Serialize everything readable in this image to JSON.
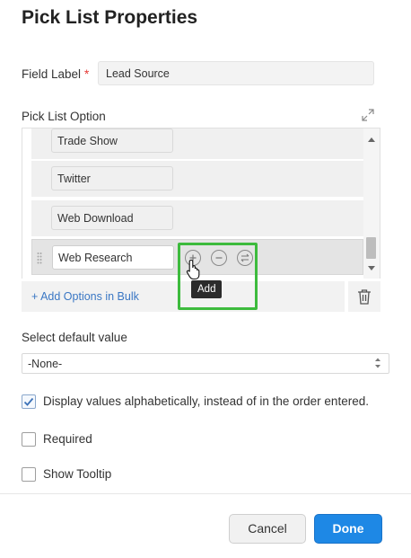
{
  "header": {
    "title": "Pick List Properties"
  },
  "field_label": {
    "label": "Field Label",
    "required_mark": "*",
    "value": "Lead Source"
  },
  "pick_list": {
    "title": "Pick List Option",
    "options": [
      {
        "value": "Trade Show"
      },
      {
        "value": "Twitter"
      },
      {
        "value": "Web Download"
      },
      {
        "value": "Web Research"
      }
    ],
    "bulk_link": "+ Add Options in Bulk",
    "tooltip": "Add",
    "scroll_position": 0.92
  },
  "default_value": {
    "label": "Select default value",
    "selected": "-None-"
  },
  "checkboxes": {
    "alphabetical": {
      "label": "Display values alphabetically, instead of in the order entered.",
      "checked": true
    },
    "required": {
      "label": "Required",
      "checked": false
    },
    "tooltip": {
      "label": "Show Tooltip",
      "checked": false
    }
  },
  "footer": {
    "cancel_label": "Cancel",
    "done_label": "Done"
  },
  "colors": {
    "accent": "#1e88e5",
    "link": "#3a77c4",
    "highlight": "#3dbb3d",
    "required": "#e53935"
  }
}
